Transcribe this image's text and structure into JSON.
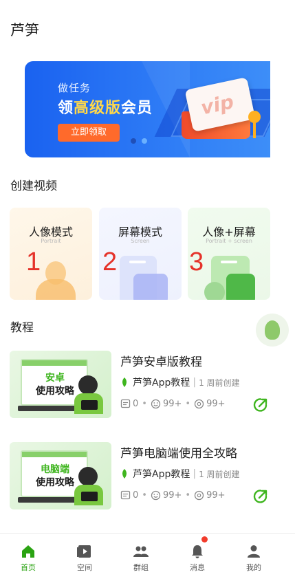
{
  "app": {
    "title": "芦笋"
  },
  "banner": {
    "subtitle": "做任务",
    "headline_prefix": "领",
    "headline_highlight": "高级版",
    "headline_suffix": "会员",
    "button_label": "立即领取",
    "card_text": "vip",
    "active_dot_index": 1,
    "dot_count": 2
  },
  "create": {
    "title": "创建视频",
    "modes": [
      {
        "title": "人像模式",
        "subtitle": "Portrait",
        "number": "1"
      },
      {
        "title": "屏幕模式",
        "subtitle": "Screen",
        "number": "2"
      },
      {
        "title": "人像+屏幕",
        "subtitle": "Portrait + screen",
        "number": "3"
      }
    ]
  },
  "tutorials": {
    "title": "教程",
    "items": [
      {
        "thumb_line1": "安卓",
        "thumb_line2": "使用攻略",
        "title": "芦笋安卓版教程",
        "author": "芦笋App教程",
        "time": "1 周前创建",
        "comments": "0",
        "likes": "99+",
        "views": "99+"
      },
      {
        "thumb_line1": "电脑端",
        "thumb_line2": "使用攻略",
        "title": "芦笋电脑端使用全攻略",
        "author": "芦笋App教程",
        "time": "1 周前创建",
        "comments": "0",
        "likes": "99+",
        "views": "99+"
      }
    ]
  },
  "nav": {
    "items": [
      {
        "label": "首页",
        "icon": "home-icon",
        "active": true
      },
      {
        "label": "空间",
        "icon": "play-icon",
        "active": false
      },
      {
        "label": "群组",
        "icon": "group-icon",
        "active": false
      },
      {
        "label": "消息",
        "icon": "bell-icon",
        "active": false,
        "badge": true
      },
      {
        "label": "我的",
        "icon": "user-icon",
        "active": false
      }
    ]
  },
  "colors": {
    "accent_green": "#2aa312",
    "banner_blue": "#1a62f0",
    "number_red": "#e5332a",
    "badge_red": "#f23c2c"
  }
}
